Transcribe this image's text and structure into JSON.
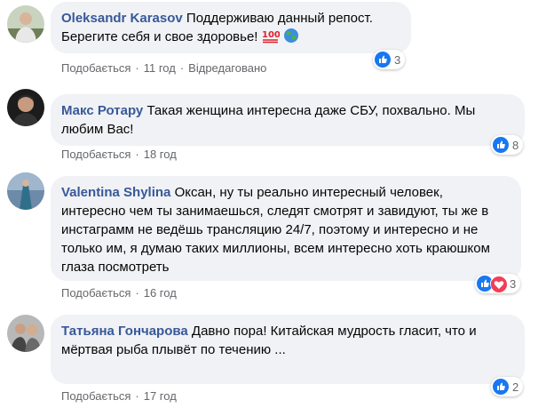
{
  "comments": [
    {
      "author": "Oleksandr Karasov",
      "text": "Поддерживаю данный репост. Берегите себя и свое здоровье!",
      "emojis": [
        "hundred-points-icon",
        "globe-icon"
      ],
      "like_label": "Подобається",
      "time": "11 год",
      "edited": "Відредаговано",
      "reaction_count": "3",
      "reaction_icons": [
        "like-icon"
      ]
    },
    {
      "author": "Макс Ротару",
      "text": "Такая женщина интересна даже СБУ, похвально. Мы любим Вас!",
      "like_label": "Подобається",
      "time": "18 год",
      "reaction_count": "8",
      "reaction_icons": [
        "like-icon"
      ]
    },
    {
      "author": "Valentina Shylina",
      "text": "Оксан, ну ты реально интересный человек, интересно чем ты занимаешься, следят смотрят и завидуют, ты же в инстаграмм не ведёшь трансляцию 24/7, поэтому и интересно и не только им, я думаю таких миллионы, всем интересно хоть краюшком глаза посмотреть",
      "like_label": "Подобається",
      "time": "16 год",
      "reaction_count": "3",
      "reaction_icons": [
        "like-icon",
        "love-icon"
      ]
    },
    {
      "author": "Татьяна Гончарова",
      "text": "Давно пора! Китайская мудрость гласит, что и мёртвая рыба плывёт по течению ...",
      "like_label": "Подобається",
      "time": "17 год",
      "reaction_count": "2",
      "reaction_icons": [
        "like-icon"
      ]
    }
  ],
  "colors": {
    "author": "#385898",
    "bubble": "#f0f2f5",
    "meta": "#65676b",
    "like_blue": "#1877f2",
    "love_red": "#f33e58"
  }
}
